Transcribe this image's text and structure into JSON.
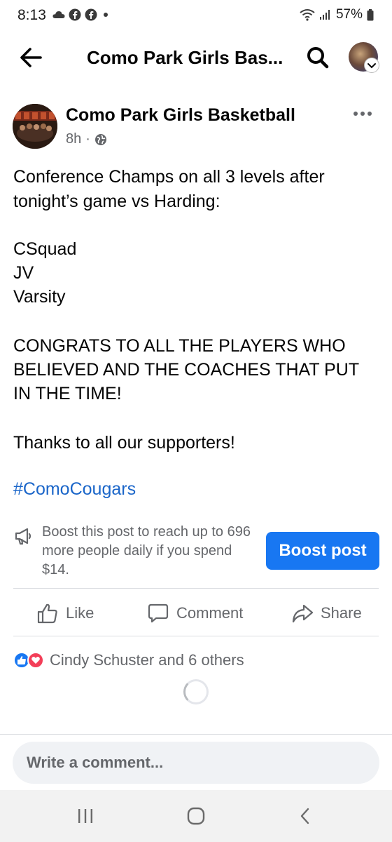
{
  "status_bar": {
    "time": "8:13",
    "battery": "57%"
  },
  "header": {
    "title": "Como Park Girls Bas..."
  },
  "post": {
    "author": "Como Park Girls Basketball",
    "time": "8h",
    "separator": "·",
    "lines": [
      "Conference Champs on all 3 levels after",
      "tonight’s game vs Harding:",
      "CSquad",
      "JV",
      "Varsity",
      "CONGRATS TO ALL THE PLAYERS WHO",
      "BELIEVED AND THE COACHES THAT PUT",
      "IN THE TIME!",
      "Thanks to all our supporters!"
    ],
    "hashtag": "#ComoCougars"
  },
  "boost": {
    "text": "Boost this post to reach up to 696 more people daily if you spend $14.",
    "button_label": "Boost post"
  },
  "actions": {
    "like": "Like",
    "comment": "Comment",
    "share": "Share"
  },
  "reactions": {
    "summary": "Cindy Schuster and 6 others"
  },
  "composer": {
    "placeholder": "Write a comment..."
  },
  "colors": {
    "accent": "#1877f2",
    "hashtag": "#1b66c9",
    "secondary_text": "#65676b",
    "love": "#f33e58"
  }
}
